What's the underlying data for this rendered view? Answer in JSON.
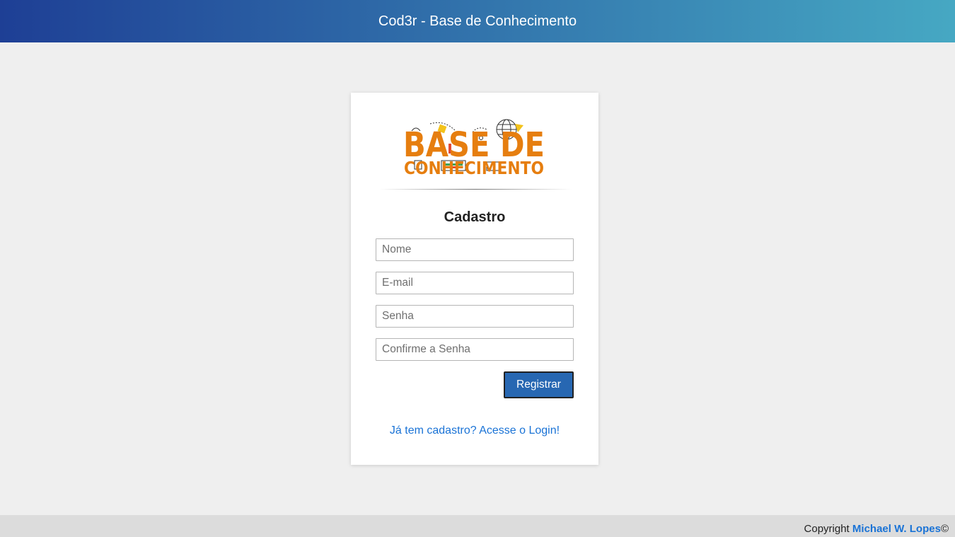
{
  "header": {
    "title": "Cod3r - Base de Conhecimento"
  },
  "logo": {
    "line1": "BASE DE",
    "line2": "CONHECIMENTO",
    "color": "#e67e0f"
  },
  "form": {
    "title": "Cadastro",
    "name_placeholder": "Nome",
    "email_placeholder": "E-mail",
    "password_placeholder": "Senha",
    "confirm_placeholder": "Confirme a Senha",
    "submit_label": "Registrar",
    "login_link": "Já tem cadastro? Acesse o Login!"
  },
  "footer": {
    "prefix": "Copyright",
    "author": "Michael W. Lopes",
    "symbol": "©"
  },
  "colors": {
    "header_start": "#1e3f95",
    "header_end": "#46a8c3",
    "button": "#2767b2",
    "link": "#1a73d6",
    "background": "#efefef"
  }
}
